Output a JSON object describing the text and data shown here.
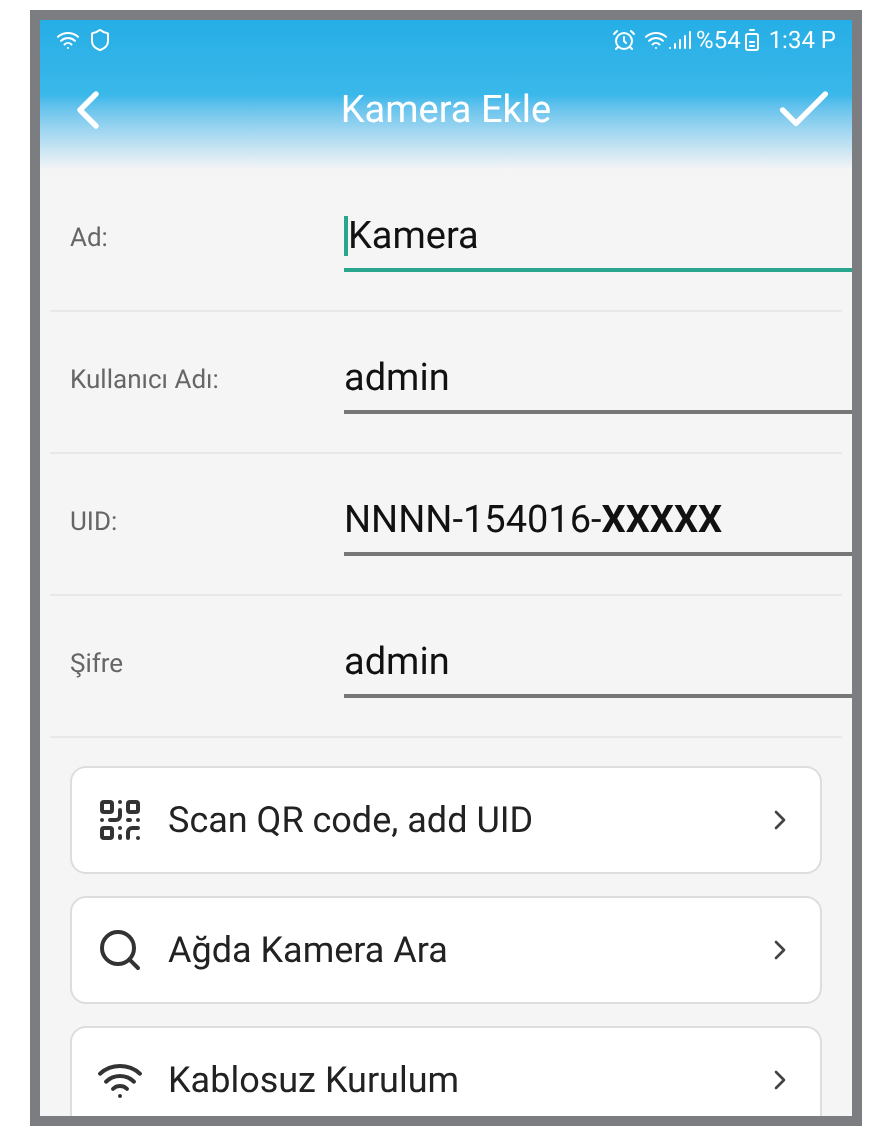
{
  "status_bar": {
    "battery": "%54",
    "time": "1:34 P"
  },
  "header": {
    "title": "Kamera Ekle"
  },
  "fields": [
    {
      "label": "Ad:",
      "value": "Kamera",
      "focused": true
    },
    {
      "label": "Kullanıcı Adı:",
      "value": "admin",
      "focused": false
    },
    {
      "label": "UID:",
      "value": "NNNN-154016-**XXXXX**",
      "focused": false
    },
    {
      "label": "Şifre",
      "value": "admin",
      "focused": false
    }
  ],
  "actions": [
    {
      "kind": "qr",
      "label": "Scan QR code, add UID"
    },
    {
      "kind": "search",
      "label": "Ağda Kamera Ara"
    },
    {
      "kind": "wifi",
      "label": "Kablosuz Kurulum"
    }
  ]
}
